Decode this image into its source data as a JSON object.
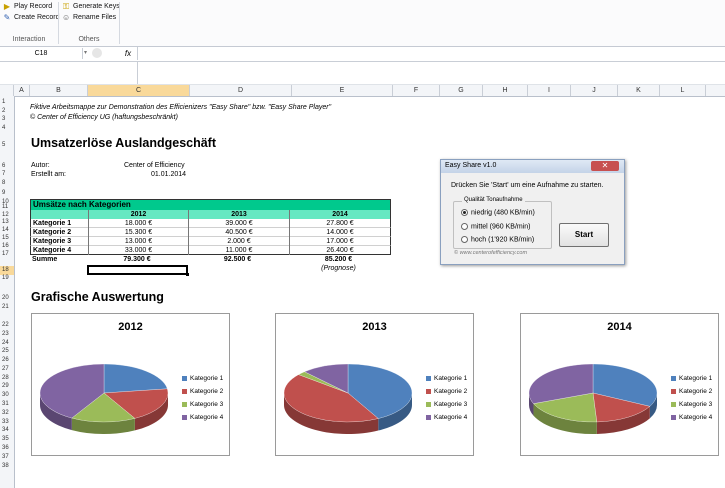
{
  "ribbon": {
    "play_record": "Play Record",
    "create_record": "Create Record",
    "generate_keys": "Generate Keys",
    "rename_files": "Rename Files",
    "group_interaction": "Interaction",
    "group_others": "Others"
  },
  "formula_bar": {
    "name_box": "C18",
    "fx": "fx",
    "content": ""
  },
  "columns": [
    "A",
    "B",
    "C",
    "D",
    "E",
    "F",
    "G",
    "H",
    "I",
    "J",
    "K",
    "L"
  ],
  "selected_column": "C",
  "rows": [
    "1",
    "2",
    "3",
    "4",
    "5",
    "6",
    "7",
    "8",
    "9",
    "10",
    "11",
    "12",
    "13",
    "14",
    "15",
    "16",
    "17",
    "18",
    "19",
    "20",
    "21",
    "22",
    "23",
    "24",
    "25",
    "26",
    "27",
    "28",
    "29",
    "30",
    "31",
    "32",
    "33",
    "34",
    "35",
    "36",
    "37",
    "38"
  ],
  "selected_row": "18",
  "sheet": {
    "line1": "Fiktive Arbeitsmappe zur Demonstration des Efficienizers \"Easy Share\" bzw. \"Easy Share Player\"",
    "line2": "© Center of Efficiency UG (haftungsbeschränkt)",
    "title": "Umsatzerlöse Auslandgeschäft",
    "author_label": "Autor:",
    "author_value": "Center of Efficiency",
    "created_label": "Erstellt am:",
    "created_value": "01.01.2014",
    "table_title": "Umsätze nach Kategorien",
    "years": [
      "2012",
      "2013",
      "2014"
    ],
    "table_rows": [
      {
        "label": "Kategorie 1",
        "v2012": "18.000 €",
        "v2013": "39.000 €",
        "v2014": "27.800 €"
      },
      {
        "label": "Kategorie 2",
        "v2012": "15.300 €",
        "v2013": "40.500 €",
        "v2014": "14.000 €"
      },
      {
        "label": "Kategorie 3",
        "v2012": "13.000 €",
        "v2013": "2.000 €",
        "v2014": "17.000 €"
      },
      {
        "label": "Kategorie 4",
        "v2012": "33.000 €",
        "v2013": "11.000 €",
        "v2014": "26.400 €"
      }
    ],
    "sum_label": "Summe",
    "sum_2012": "79.300 €",
    "sum_2013": "92.500 €",
    "sum_2014": "85.200 €",
    "forecast_note": "(Prognose)",
    "section2_title": "Grafische Auswertung"
  },
  "dialog": {
    "title": "Easy Share v1.0",
    "close": "✕",
    "instruction": "Drücken Sie 'Start'  um eine Aufnahme zu starten.",
    "group_label": "Qualität Tonaufnahme",
    "options": [
      "niedrig (480 KB/min)",
      "mittel (960 KB/min)",
      "hoch (1'920 KB/min)"
    ],
    "selected_option": 0,
    "start_button": "Start",
    "footer": "© www.centerofefficiency.com"
  },
  "colors": {
    "table_header": "#00c98d",
    "table_year_row": "#66e8c2",
    "kategorie1": "#4f81bd",
    "kategorie2": "#c0504d",
    "kategorie3": "#9bbb59",
    "kategorie4": "#8064a2"
  },
  "chart_data": [
    {
      "type": "pie",
      "title": "2012",
      "categories": [
        "Kategorie 1",
        "Kategorie 2",
        "Kategorie 3",
        "Kategorie 4"
      ],
      "values": [
        18000,
        15300,
        13000,
        33000
      ],
      "legend": "right"
    },
    {
      "type": "pie",
      "title": "2013",
      "categories": [
        "Kategorie 1",
        "Kategorie 2",
        "Kategorie 3",
        "Kategorie 4"
      ],
      "values": [
        39000,
        40500,
        2000,
        11000
      ],
      "legend": "right"
    },
    {
      "type": "pie",
      "title": "2014",
      "categories": [
        "Kategorie 1",
        "Kategorie 2",
        "Kategorie 3",
        "Kategorie 4"
      ],
      "values": [
        27800,
        14000,
        17000,
        26400
      ],
      "legend": "right"
    }
  ]
}
